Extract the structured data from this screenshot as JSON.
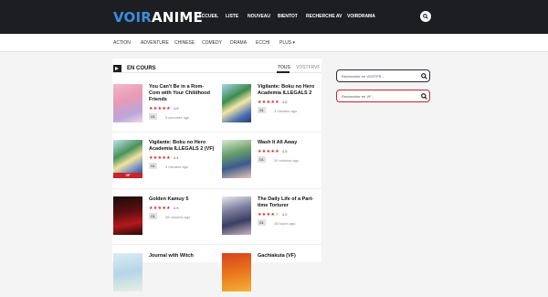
{
  "header": {
    "logo_part1": "VOIR",
    "logo_part2": "ANIME",
    "nav": [
      "ACCUEIL",
      "LISTE",
      "NOUVEAU",
      "BIENTOT",
      "RECHERCHE AV",
      "VOIRDRAMA"
    ]
  },
  "subnav": {
    "genres": [
      "ACTION",
      "ADVENTURE",
      "CHINESE",
      "COMEDY",
      "DRAMA",
      "ECCHI"
    ],
    "more": "PLUS ▾"
  },
  "section": {
    "title": "EN COURS",
    "tabs": [
      "TOUS",
      "VOSTFR",
      "VF"
    ],
    "active_tab": "TOUS"
  },
  "cards": [
    {
      "title": "You Can't Be in a Rom-Com with Your Childhood Friends",
      "rating": "4.5",
      "rating_fraction": 0.9,
      "episode": "01",
      "time": "5 seconde ago",
      "vf": false
    },
    {
      "title": "Vigilante: Boku no Hero Academia ILLEGALS 2",
      "rating": "4.5",
      "rating_fraction": 0.9,
      "episode": "01",
      "time": "3 minutes ago",
      "vf": false
    },
    {
      "title": "Vigilante: Boku no Hero Academia ILLEGALS 2 (VF)",
      "rating": "4.4",
      "rating_fraction": 0.88,
      "episode": "01",
      "time": "3 minutes ago",
      "vf": true
    },
    {
      "title": "Wash It All Away",
      "rating": "4.5",
      "rating_fraction": 0.9,
      "episode": "01",
      "time": "30 minutes ago",
      "vf": false
    },
    {
      "title": "Golden Kamuy 5",
      "rating": "4.9",
      "rating_fraction": 0.98,
      "episode": "01",
      "time": "36 minutes ago",
      "vf": false
    },
    {
      "title": "The Daily Life of a Part-time Torturer",
      "rating": "4.2",
      "rating_fraction": 0.84,
      "episode": "01",
      "time": "48 hours ago",
      "vf": false
    },
    {
      "title": "Journal with Witch",
      "rating": "",
      "episode": "",
      "time": "",
      "vf": false
    },
    {
      "title": "Gachiakuta (VF)",
      "rating": "",
      "episode": "",
      "time": "",
      "vf": false
    }
  ],
  "sidebar": {
    "search_vostfr_placeholder": "Rechercher en VOSTFR...",
    "search_vf_placeholder": "Rechercher en VF..."
  },
  "colors": {
    "header_bg": "#1d1e22",
    "logo_accent": "#3a8dde",
    "star": "#e02020",
    "vostfr_border": "#2a2a3a",
    "vf_border": "#c8242a"
  }
}
